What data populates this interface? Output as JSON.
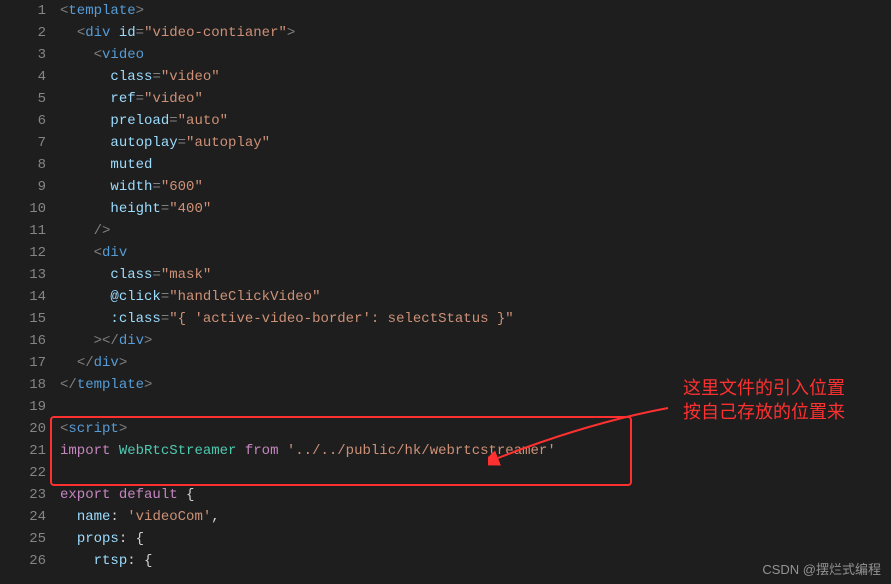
{
  "lines": {
    "1": "1",
    "2": "2",
    "3": "3",
    "4": "4",
    "5": "5",
    "6": "6",
    "7": "7",
    "8": "8",
    "9": "9",
    "10": "10",
    "11": "11",
    "12": "12",
    "13": "13",
    "14": "14",
    "15": "15",
    "16": "16",
    "17": "17",
    "18": "18",
    "19": "19",
    "20": "20",
    "21": "21",
    "22": "22",
    "23": "23",
    "24": "24",
    "25": "25",
    "26": "26"
  },
  "code": {
    "template": "template",
    "div": "div",
    "video": "video",
    "script": "script",
    "id_attr": "id",
    "id_val": "\"video-contianer\"",
    "class_attr": "class",
    "class_video": "\"video\"",
    "class_mask": "\"mask\"",
    "ref_attr": "ref",
    "ref_val": "\"video\"",
    "preload_attr": "preload",
    "preload_val": "\"auto\"",
    "autoplay_attr": "autoplay",
    "autoplay_val": "\"autoplay\"",
    "muted_attr": "muted",
    "width_attr": "width",
    "width_val": "\"600\"",
    "height_attr": "height",
    "height_val": "\"400\"",
    "click_attr": "@click",
    "click_val": "\"handleClickVideo\"",
    "bindclass_attr": ":class",
    "bindclass_val": "\"{ 'active-video-border': selectStatus }\"",
    "import_kw": "import",
    "from_kw": "from",
    "webrtc_class": "WebRtcStreamer",
    "import_path": "'../../public/hk/webrtcstreamer'",
    "export_kw": "export",
    "default_kw": "default",
    "name_prop": "name",
    "name_val": "'videoCom'",
    "props_prop": "props",
    "rtsp_prop": "rtsp"
  },
  "annotation": {
    "line1": "这里文件的引入位置",
    "line2": "按自己存放的位置来"
  },
  "watermark": "CSDN @摆烂式编程"
}
